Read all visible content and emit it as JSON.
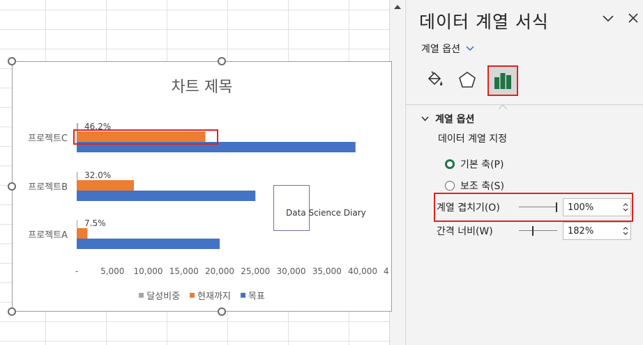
{
  "chart": {
    "title": "차트 제목",
    "watermark": "Data Science Diary",
    "legend": [
      {
        "label": "달성비중",
        "color": "#a5a5a5"
      },
      {
        "label": "현재까지",
        "color": "#ed7d31"
      },
      {
        "label": "목표",
        "color": "#4472c4"
      }
    ]
  },
  "chart_data": {
    "type": "bar",
    "orientation": "horizontal",
    "title": "차트 제목",
    "categories": [
      "프로젝트A",
      "프로젝트B",
      "프로젝트C"
    ],
    "series": [
      {
        "name": "달성비중",
        "values": [
          0.075,
          0.32,
          0.462
        ],
        "labels": [
          "7.5%",
          "32.0%",
          "46.2%"
        ]
      },
      {
        "name": "현재까지",
        "values": [
          1500,
          8000,
          18000
        ]
      },
      {
        "name": "목표",
        "values": [
          20000,
          25000,
          39000
        ]
      }
    ],
    "x_ticks": [
      "-",
      "5,000",
      "10,000",
      "15,000",
      "20,000",
      "25,000",
      "30,000",
      "35,000",
      "40,000",
      "4"
    ],
    "xlim": [
      0,
      40000
    ],
    "legend_position": "bottom"
  },
  "pane": {
    "title": "데이터 계열 서식",
    "options_dropdown": "계열 옵션",
    "section": "계열 옵션",
    "plot_on": "데이터 계열 지정",
    "primary_axis": "기본 축(P)",
    "secondary_axis": "보조 축(S)",
    "overlap_label": "계열 겹치기(O)",
    "overlap_value": "100%",
    "overlap_level": 1.0,
    "gap_label": "간격 너비(W)",
    "gap_value": "182%",
    "gap_level": 0.364
  },
  "colors": {
    "accent_green": "#217346",
    "highlight_red": "#e0211d"
  }
}
